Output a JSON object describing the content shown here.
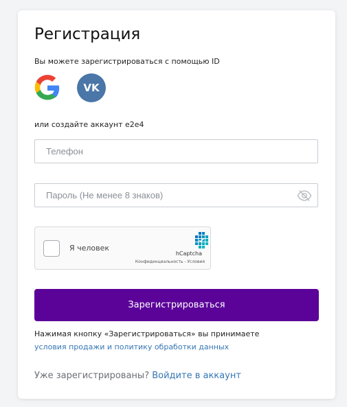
{
  "header": {
    "title": "Регистрация"
  },
  "social": {
    "prompt": "Вы можете зарегистрироваться с помощью ID",
    "providers": [
      "google",
      "vk"
    ],
    "vk_label": "VK",
    "colors": {
      "vk": "#4a76a8",
      "google_blue": "#4285f4",
      "google_red": "#ea4335",
      "google_yellow": "#fbbc05",
      "google_green": "#34a853"
    }
  },
  "form": {
    "or_create": "или создайте аккаунт e2e4",
    "phone_placeholder": "Телефон",
    "phone_value": "",
    "password_placeholder": "Пароль (Не менее 8 знаков)",
    "password_value": "",
    "password_toggle_icon": "eye-hidden-icon"
  },
  "captcha": {
    "label": "Я человек",
    "brand": "hCaptcha",
    "links": "Конфиденциальность - Условия",
    "checked": false
  },
  "submit": {
    "label": "Зарегистрироваться",
    "color": "#5b0299"
  },
  "terms": {
    "text": "Нажимая кнопку «Зарегистрироваться» вы принимаете",
    "link": "условия продажи и политику обработки данных",
    "link_color": "#3576b5"
  },
  "footer": {
    "already_text": "Уже зарегистрированы?",
    "login_link": "Войдите в аккаунт"
  }
}
